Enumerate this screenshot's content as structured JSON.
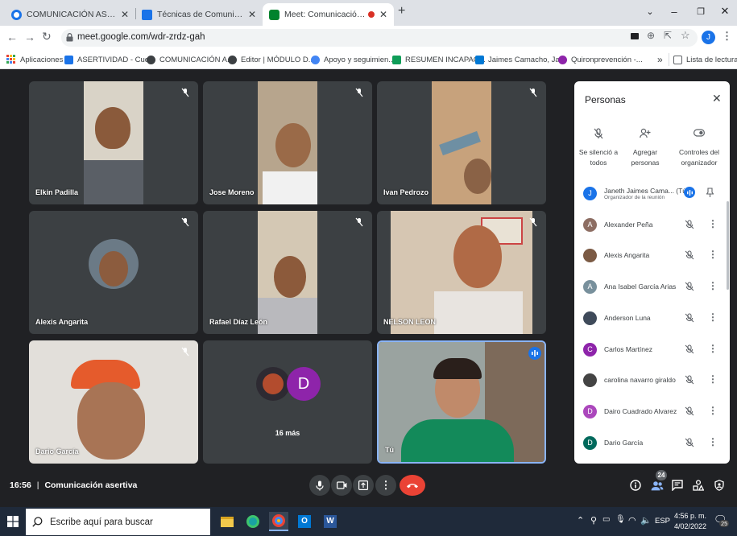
{
  "browser": {
    "tabs": [
      {
        "title": "COMUNICACIÓN ASERTIVA por",
        "fav": "#1a73e8",
        "fav_icon": "chrome-icon"
      },
      {
        "title": "Técnicas de Comunicación Asert",
        "fav": "#1a73e8",
        "fav_icon": "tile-icon"
      },
      {
        "title": "Meet: Comunicación asertiva",
        "fav": "#00832d",
        "fav_icon": "meet-icon"
      }
    ],
    "new_tab": "+",
    "url": "meet.google.com/wdr-zrdz-gah",
    "profile_initial": "J",
    "bookmarks": [
      {
        "label": "Aplicaciones",
        "color": "#ea4335"
      },
      {
        "label": "ASERTIVIDAD - Cue...",
        "color": "#1a73e8"
      },
      {
        "label": "COMUNICACIÓN A...",
        "color": "#3c4043"
      },
      {
        "label": "Editor | MÓDULO D...",
        "color": "#3c4043"
      },
      {
        "label": "Apoyo y seguimien...",
        "color": "#4285f4"
      },
      {
        "label": "RESUMEN INCAPAC...",
        "color": "#0f9d58"
      },
      {
        "label": "Jaimes Camacho, Ja...",
        "color": "#0078d4"
      },
      {
        "label": "Quironprevención -...",
        "color": "#8e24aa"
      }
    ],
    "bookmarks_more": "»",
    "reading_list": "Lista de lectura"
  },
  "meet": {
    "tiles": [
      {
        "name": "Elkin Padilla",
        "muted": true,
        "bg": "#d9d3c7",
        "skin": "#8a5a3b"
      },
      {
        "name": "Jose Moreno",
        "muted": true,
        "bg": "#b7a58d",
        "skin": "#9a6a48"
      },
      {
        "name": "Ivan Pedrozo",
        "muted": true,
        "bg": "#c7a27c",
        "skin": "#8a6246"
      },
      {
        "name": "Alexis Angarita",
        "muted": true,
        "avatar": true,
        "bg": "#3c4043",
        "skin": "#8c5c3e"
      },
      {
        "name": "Rafael Díaz León",
        "muted": true,
        "bg": "#d4c8b4",
        "skin": "#8c5a3b"
      },
      {
        "name": "NELSON LEON",
        "muted": true,
        "bg": "#d6c6b2",
        "skin": "#b06a46"
      },
      {
        "name": "Dario García",
        "muted": true,
        "bg": "#e2dfda",
        "skin": "#a87455"
      },
      {
        "name": "",
        "more_label": "16 más",
        "letter": "D"
      },
      {
        "name": "Tú",
        "muted": false,
        "self": true,
        "bg": "#9aa3a0",
        "skin": "#c08a6a"
      }
    ],
    "panel": {
      "title": "Personas",
      "actions": [
        "Se silenció a todos",
        "Agregar personas",
        "Controles del organizador"
      ],
      "people": [
        {
          "name": "Janeth Jaimes Cama... (Tú)",
          "sub": "Organizador de la reunión",
          "initial": "J",
          "color": "#1a73e8"
        },
        {
          "name": "Alexander Peña",
          "initial": "A",
          "color": "#8d6e63"
        },
        {
          "name": "Alexis Angarita",
          "initial": "",
          "color": "#7b5a44"
        },
        {
          "name": "Ana Isabel García Arias",
          "initial": "A",
          "color": "#78909c"
        },
        {
          "name": "Anderson Luna",
          "initial": "",
          "color": "#3f4a5a"
        },
        {
          "name": "Carlos Martínez",
          "initial": "C",
          "color": "#8e24aa"
        },
        {
          "name": "carolina navarro giraldo",
          "initial": "",
          "color": "#444444"
        },
        {
          "name": "Dairo Cuadrado Alvarez",
          "initial": "D",
          "color": "#ab47bc"
        },
        {
          "name": "Dario García",
          "initial": "D",
          "color": "#00695c"
        }
      ]
    },
    "bottom": {
      "time": "16:56",
      "separator": "|",
      "meeting_name": "Comunicación asertiva",
      "participant_count": "24"
    }
  },
  "taskbar": {
    "search_placeholder": "Escribe aquí para buscar",
    "lang": "ESP",
    "time": "4:56 p. m.",
    "date": "4/02/2022",
    "notif_count": "25"
  }
}
